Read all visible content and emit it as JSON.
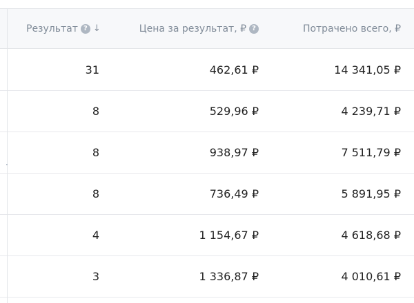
{
  "columns": {
    "result": {
      "label": "Результат",
      "help_icon": "question-circle-icon",
      "sort_icon": "arrow-down-icon",
      "sort_glyph": "↓",
      "help_glyph": "?"
    },
    "cost_per_result": {
      "label": "Цена за результат, ₽",
      "help_icon": "question-circle-icon",
      "help_glyph": "?"
    },
    "spent_total": {
      "label": "Потрачено всего, ₽"
    }
  },
  "rows": [
    {
      "result": "31",
      "cost_per_result": "462,61 ₽",
      "spent_total": "14 341,05 ₽"
    },
    {
      "result": "8",
      "cost_per_result": "529,96 ₽",
      "spent_total": "4 239,71 ₽"
    },
    {
      "result": "8",
      "cost_per_result": "938,97 ₽",
      "spent_total": "7 511,79 ₽"
    },
    {
      "result": "8",
      "cost_per_result": "736,49 ₽",
      "spent_total": "5 891,95 ₽"
    },
    {
      "result": "4",
      "cost_per_result": "1 154,67 ₽",
      "spent_total": "4 618,68 ₽"
    },
    {
      "result": "3",
      "cost_per_result": "1 336,87 ₽",
      "spent_total": "4 010,61 ₽"
    }
  ],
  "colors": {
    "header_bg": "#f7f8fa",
    "header_text": "#818c99",
    "cell_text": "#222222",
    "divider": "#e7e8ec",
    "help_icon_bg": "#aeb7c2"
  }
}
